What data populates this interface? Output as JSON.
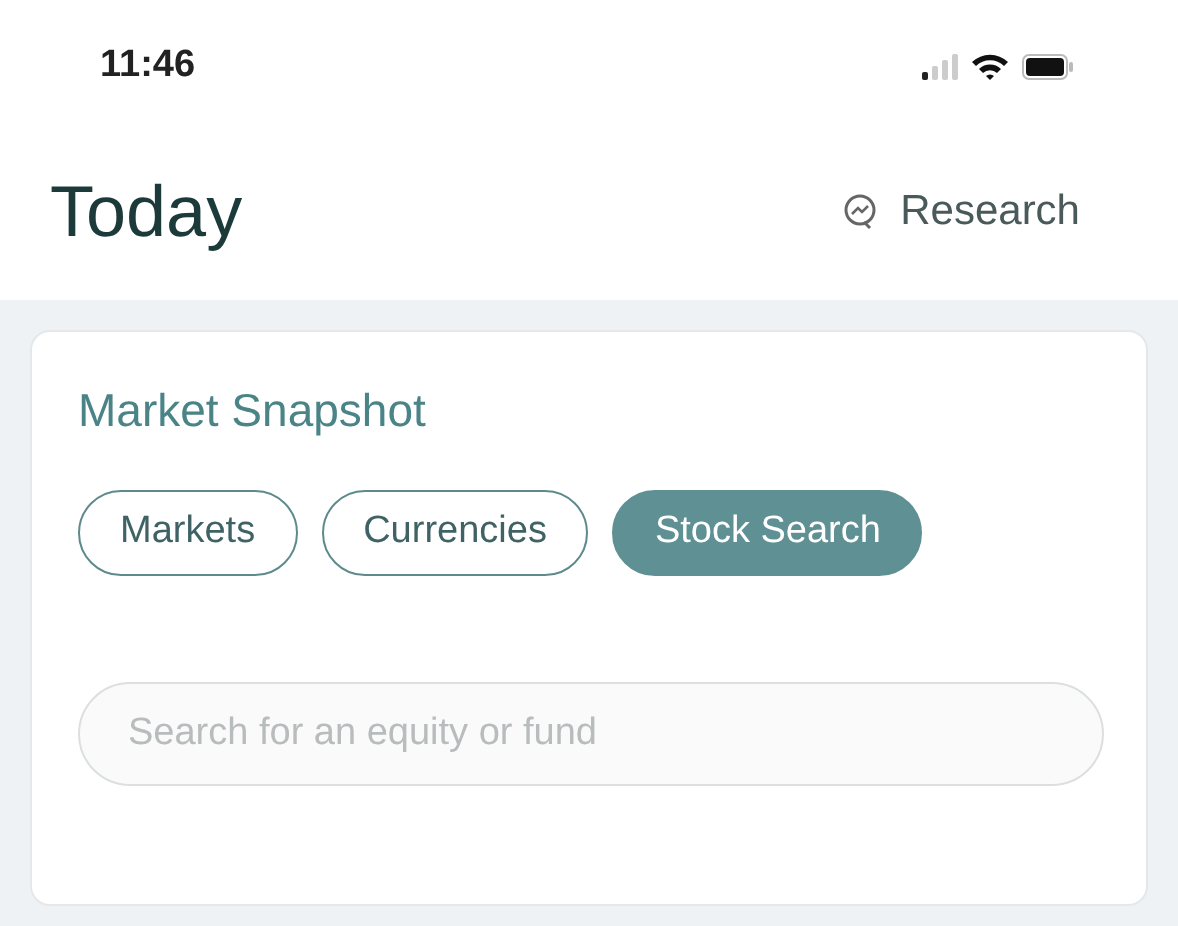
{
  "status_bar": {
    "time": "11:46"
  },
  "header": {
    "title": "Today",
    "action": "Research"
  },
  "card": {
    "title": "Market Snapshot",
    "tabs": [
      {
        "label": "Markets",
        "selected": false
      },
      {
        "label": "Currencies",
        "selected": false
      },
      {
        "label": "Stock Search",
        "selected": true
      }
    ],
    "search": {
      "placeholder": "Search for an equity or fund"
    }
  }
}
